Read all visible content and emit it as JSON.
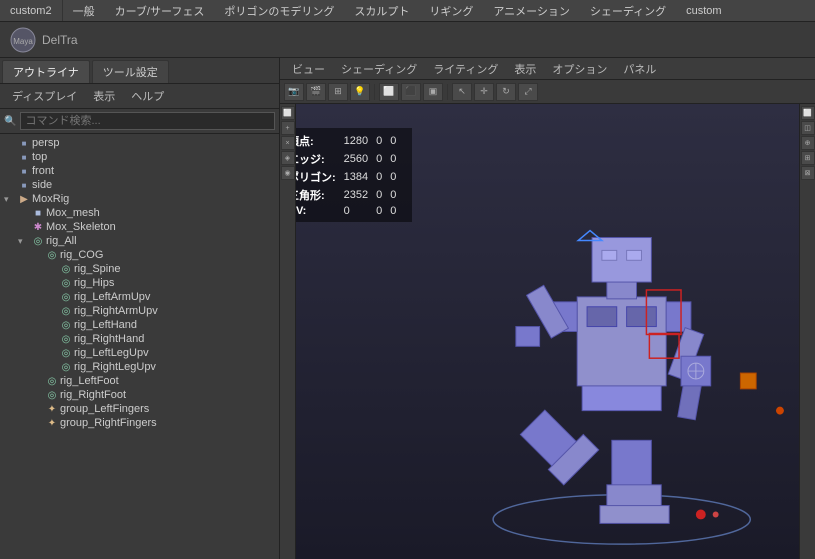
{
  "app": {
    "title": "custom2",
    "logo_text": "DelTra"
  },
  "top_menu": {
    "items": [
      "一般",
      "カーブ/サーフェス",
      "ポリゴンのモデリング",
      "スカルプト",
      "リギング",
      "アニメーション",
      "シェーディング",
      "custom"
    ]
  },
  "left_panel": {
    "tabs": [
      "アウトライナ",
      "ツール設定"
    ],
    "subtabs": [
      "ディスプレイ",
      "表示",
      "ヘルプ"
    ],
    "search_placeholder": "コマンド検索...",
    "tree_items": [
      {
        "id": "persp",
        "label": "persp",
        "level": 0,
        "icon": "camera",
        "expand": false
      },
      {
        "id": "top",
        "label": "top",
        "level": 0,
        "icon": "camera",
        "expand": false
      },
      {
        "id": "front",
        "label": "front",
        "level": 0,
        "icon": "camera",
        "expand": false
      },
      {
        "id": "side",
        "label": "side",
        "level": 0,
        "icon": "camera",
        "expand": false
      },
      {
        "id": "MoxRig",
        "label": "MoxRig",
        "level": 0,
        "icon": "group",
        "expand": true
      },
      {
        "id": "Mox_mesh",
        "label": "Mox_mesh",
        "level": 1,
        "icon": "mesh",
        "expand": false
      },
      {
        "id": "Mox_Skeleton",
        "label": "Mox_Skeleton",
        "level": 1,
        "icon": "joint",
        "expand": false
      },
      {
        "id": "rig_All",
        "label": "rig_All",
        "level": 1,
        "icon": "rig",
        "expand": true
      },
      {
        "id": "rig_COG",
        "label": "rig_COG",
        "level": 2,
        "icon": "rig",
        "expand": false
      },
      {
        "id": "rig_Spine",
        "label": "rig_Spine",
        "level": 3,
        "icon": "rig",
        "expand": false
      },
      {
        "id": "rig_Hips",
        "label": "rig_Hips",
        "level": 3,
        "icon": "rig",
        "expand": false
      },
      {
        "id": "rig_LeftArmUpv",
        "label": "rig_LeftArmUpv",
        "level": 3,
        "icon": "rig",
        "expand": false
      },
      {
        "id": "rig_RightArmUpv",
        "label": "rig_RightArmUpv",
        "level": 3,
        "icon": "rig",
        "expand": false
      },
      {
        "id": "rig_LeftHand",
        "label": "rig_LeftHand",
        "level": 3,
        "icon": "rig",
        "expand": false
      },
      {
        "id": "rig_RightHand",
        "label": "rig_RightHand",
        "level": 3,
        "icon": "rig",
        "expand": false
      },
      {
        "id": "rig_LeftLegUpv",
        "label": "rig_LeftLegUpv",
        "level": 3,
        "icon": "rig",
        "expand": false
      },
      {
        "id": "rig_RightLegUpv",
        "label": "rig_RightLegUpv",
        "level": 3,
        "icon": "rig",
        "expand": false
      },
      {
        "id": "rig_LeftFoot",
        "label": "rig_LeftFoot",
        "level": 2,
        "icon": "rig",
        "expand": false
      },
      {
        "id": "rig_RightFoot",
        "label": "rig_RightFoot",
        "level": 2,
        "icon": "rig",
        "expand": false
      },
      {
        "id": "group_LeftFingers",
        "label": "group_LeftFingers",
        "level": 2,
        "icon": "group2",
        "expand": false
      },
      {
        "id": "group_RightFingers",
        "label": "group_RightFingers",
        "level": 2,
        "icon": "group2",
        "expand": false
      }
    ]
  },
  "viewport": {
    "tabs": [
      "ビュー",
      "シェーディング",
      "ライティング",
      "表示",
      "オプション",
      "パネル"
    ],
    "stats": {
      "vertices_label": "頂点:",
      "vertices_value": "1280",
      "edges_label": "エッジ:",
      "edges_value": "2560",
      "polygons_label": "ポリゴン:",
      "polygons_value": "1384",
      "triangles_label": "三角形:",
      "triangles_value": "2352",
      "uv_label": "UV:",
      "uv_value": "0",
      "col2": "0",
      "col3": "0"
    }
  },
  "colors": {
    "robot_body": "#7878cc",
    "robot_dark": "#5555aa",
    "viewport_bg": "#2e2e40",
    "selection_red": "#cc0000"
  }
}
